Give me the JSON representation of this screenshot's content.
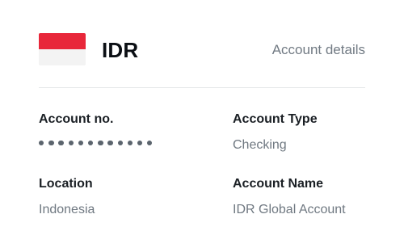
{
  "header": {
    "currency_code": "IDR",
    "account_details_link": "Account details",
    "flag": {
      "name": "indonesia-flag",
      "top_color": "#e8273a",
      "bottom_color": "#f3f3f3"
    }
  },
  "fields": {
    "account_no": {
      "label": "Account no.",
      "masked_dots": 12
    },
    "account_type": {
      "label": "Account Type",
      "value": "Checking"
    },
    "location": {
      "label": "Location",
      "value": "Indonesia"
    },
    "account_name": {
      "label": "Account Name",
      "value": "IDR Global Account"
    }
  },
  "colors": {
    "label_text": "#1a1f24",
    "value_text": "#6f7881",
    "link_text": "#717a83",
    "divider": "#e6e8ea"
  }
}
